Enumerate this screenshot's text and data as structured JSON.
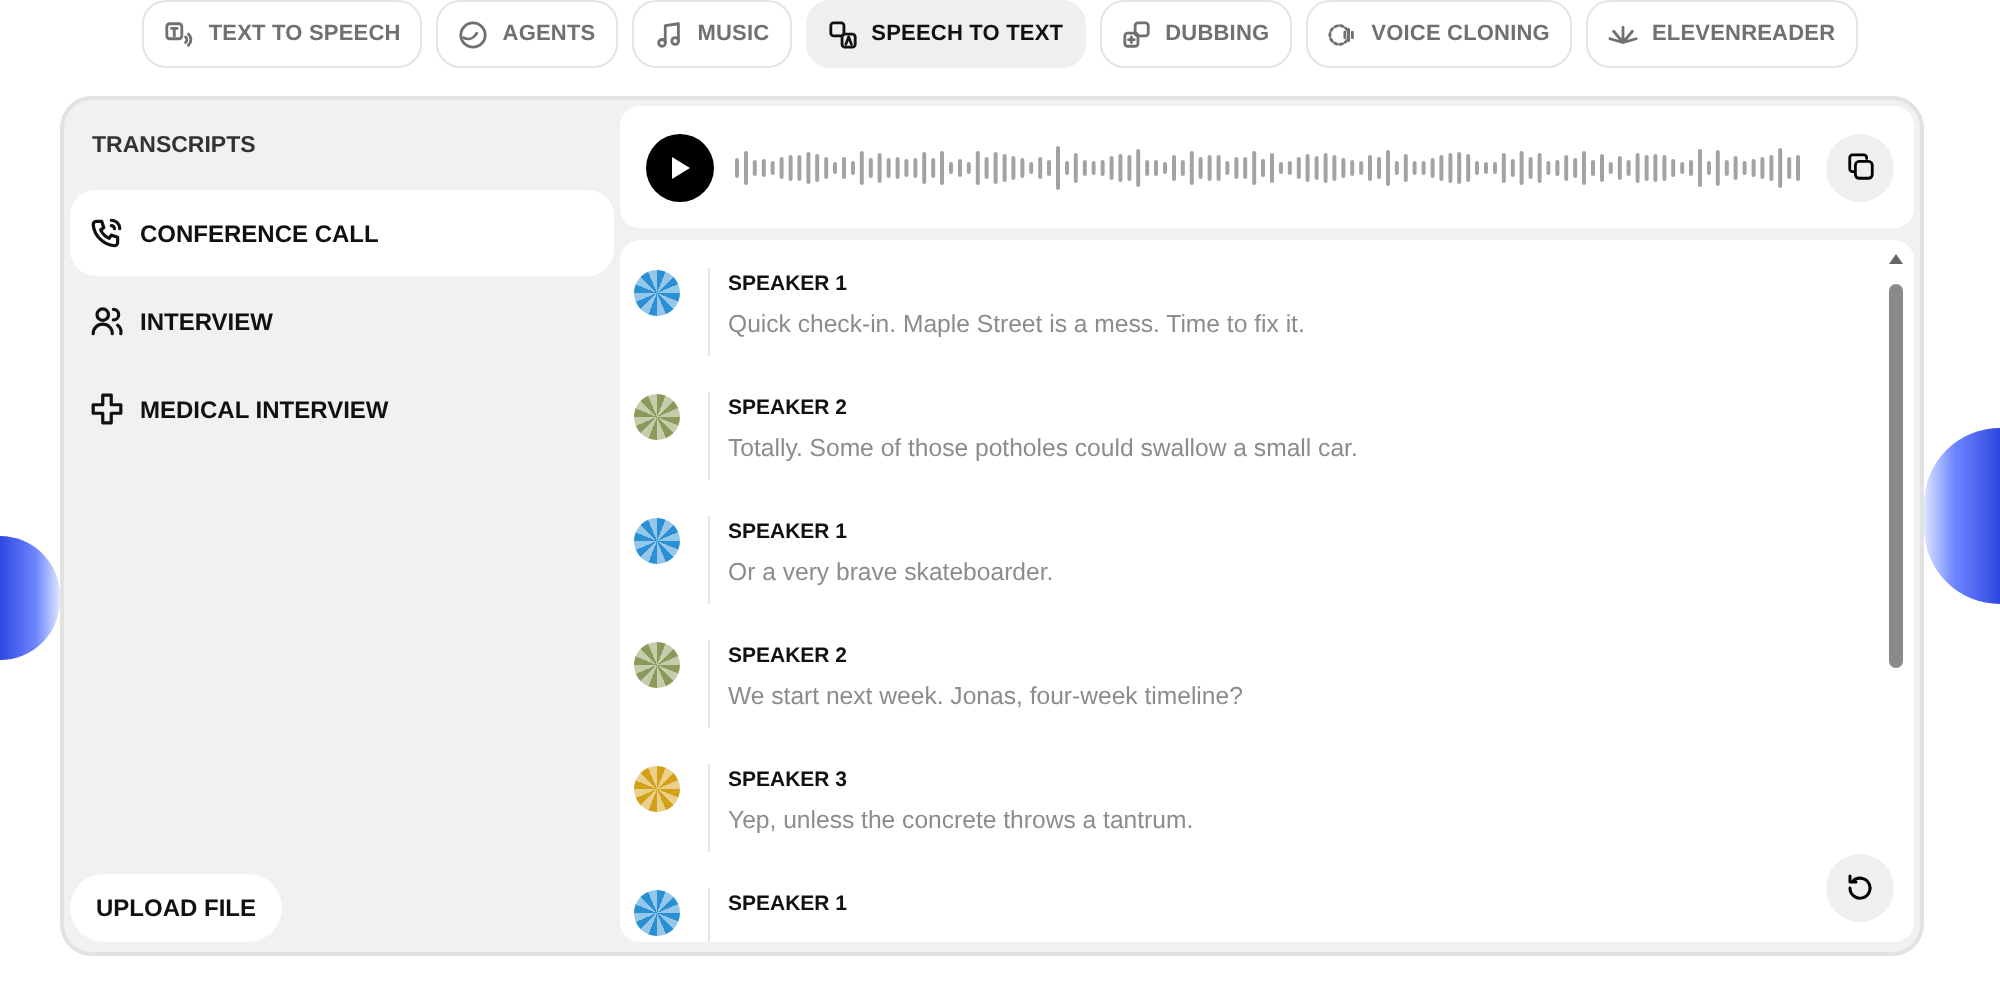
{
  "tabs": [
    {
      "label": "TEXT TO SPEECH",
      "selected": false
    },
    {
      "label": "AGENTS",
      "selected": false
    },
    {
      "label": "MUSIC",
      "selected": false
    },
    {
      "label": "SPEECH TO TEXT",
      "selected": true
    },
    {
      "label": "DUBBING",
      "selected": false
    },
    {
      "label": "VOICE CLONING",
      "selected": false
    },
    {
      "label": "ELEVENREADER",
      "selected": false
    }
  ],
  "sidebar": {
    "title": "TRANSCRIPTS",
    "items": [
      {
        "label": "CONFERENCE CALL",
        "selected": true
      },
      {
        "label": "INTERVIEW",
        "selected": false
      },
      {
        "label": "MEDICAL INTERVIEW",
        "selected": false
      }
    ],
    "upload_button": "UPLOAD FILE"
  },
  "transcript": {
    "entries": [
      {
        "speaker": "SPEAKER 1",
        "text": "Quick check-in. Maple Street is a mess. Time to fix it.",
        "color": "#2b8fd4"
      },
      {
        "speaker": "SPEAKER 2",
        "text": "Totally. Some of those potholes could swallow a small car.",
        "color": "#8b9a5a"
      },
      {
        "speaker": "SPEAKER 1",
        "text": "Or a very brave skateboarder.",
        "color": "#2b8fd4"
      },
      {
        "speaker": "SPEAKER 2",
        "text": "We start next week. Jonas, four-week timeline?",
        "color": "#8b9a5a"
      },
      {
        "speaker": "SPEAKER 3",
        "text": "Yep, unless the concrete throws a tantrum.",
        "color": "#d4a017"
      },
      {
        "speaker": "SPEAKER 1",
        "color": "#2b8fd4"
      }
    ]
  }
}
